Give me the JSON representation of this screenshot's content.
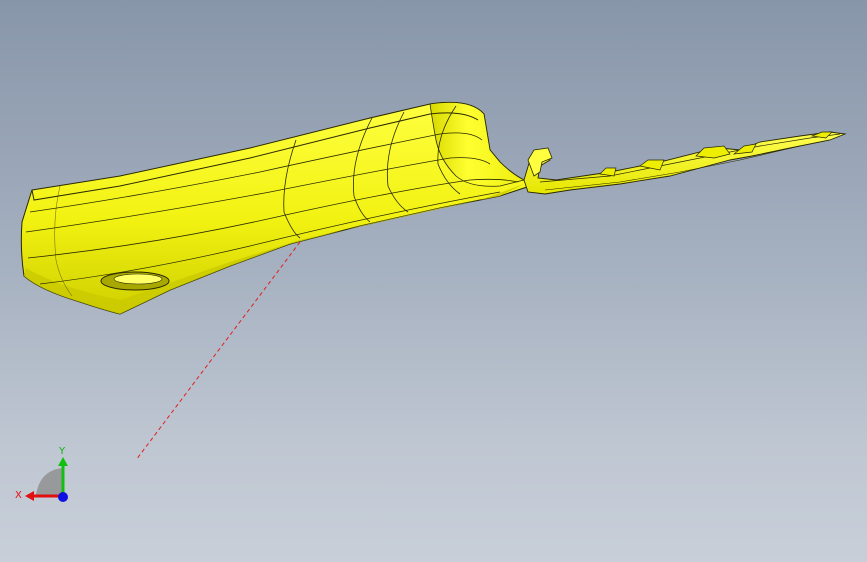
{
  "viewport": {
    "background_top": "#8896aa",
    "background_bottom": "#c8cfd9"
  },
  "model": {
    "part_color": "#ffff1a",
    "shade_color": "#c8c800",
    "edge_color": "#1a1a00",
    "sketch_line_color": "#e02020"
  },
  "triad": {
    "x_label": "X",
    "y_label": "Y",
    "x_color": "#e01010",
    "y_color": "#10c010",
    "z_color": "#1010e0"
  }
}
